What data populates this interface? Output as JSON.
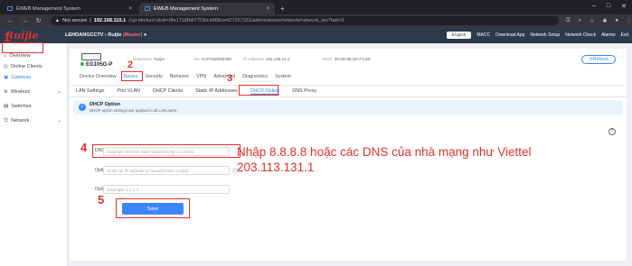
{
  "tabs": [
    {
      "title": "EWEB Management System",
      "active": false
    },
    {
      "title": "EWEB Management System",
      "active": true
    }
  ],
  "url": {
    "secure_label": "Not secure",
    "host": "192.168.110.1",
    "path": "/cgi-bin/luci/;stok=9fa1718fbb77f36cb86bce427257331/admin/alone/network/network_lan?tab=3"
  },
  "header": {
    "logo": "Ruijie",
    "site_name": "LEHOANGCCTV",
    "site_sep": " › ",
    "device": "Ruijie",
    "master": "(Master)",
    "language": "English",
    "links": [
      "MACC",
      "Download App",
      "Network Setup",
      "Network Check",
      "Alarms",
      "Exit"
    ]
  },
  "sidebar": {
    "items": [
      {
        "label": "Overview"
      },
      {
        "label": "Online Clients"
      },
      {
        "label": "Gateway"
      },
      {
        "label": "Wireless"
      },
      {
        "label": "Switches"
      },
      {
        "label": "Network"
      }
    ]
  },
  "device": {
    "model": "EG105G-P",
    "hostname_label": "Hostname:",
    "hostname": "Ruijie",
    "sn_label": "SN:",
    "sn": "H1PH6Z000389",
    "ip_label": "IP Address:",
    "ip": "192.168.12.2",
    "mac_label": "MAC:",
    "mac": "30:0D:9E:EF:F1:6D",
    "reboot": "Reboot"
  },
  "menu": {
    "items": [
      "Device Overview",
      "Basics",
      "Security",
      "Behavior",
      "VPN",
      "Advanced",
      "Diagnostics",
      "System"
    ]
  },
  "subtabs": {
    "items": [
      "LAN Settings",
      "Port VLAN",
      "DHCP Clients",
      "Static IP Addresses",
      "DHCP Option",
      "DNS Proxy"
    ]
  },
  "notice": {
    "title": "DHCP Option",
    "text": "DHCP option settings are applied to all LAN ports."
  },
  "form": {
    "dns_label": "DNS Server",
    "dns_placeholder": "Example: 8.8.8.8; each separated by a comma",
    "opt43_label": "Option 43",
    "opt43_placeholder": "Enter an IP address or hexadecimal number.",
    "opt138_label": "Option 138",
    "opt138_placeholder": "Example: 1.1.1.1",
    "save": "Save"
  },
  "annotations": {
    "n1": "1",
    "n2": "2",
    "n3": "3",
    "n4": "4",
    "n5": "5",
    "line1": "Nhập 8.8.8.8 hoặc các DNS của nhà mạng như Viettel",
    "line2": "203.113.131.1"
  },
  "colors": {
    "accent": "#3b86ff",
    "annotation": "#e0312c",
    "header_bg": "#2d3a4b"
  }
}
